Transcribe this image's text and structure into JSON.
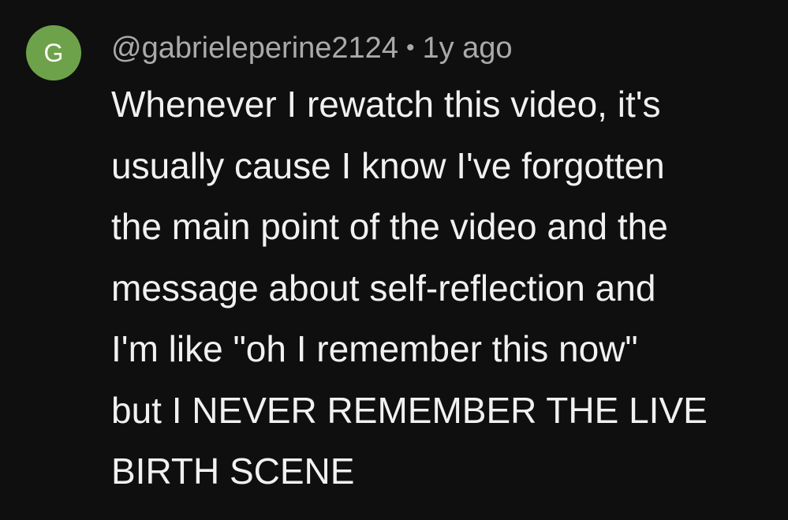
{
  "comment": {
    "avatar_letter": "G",
    "avatar_color": "#6ea24a",
    "author": "@gabrieleperine2124",
    "separator": "•",
    "time": "1y ago",
    "text_lines": [
      "Whenever I rewatch this video, it's",
      "usually cause I know I've forgotten",
      "the main point of the video and the",
      "message about self-reflection and",
      "I'm like \"oh I remember this now\"",
      "but I NEVER REMEMBER THE LIVE",
      "BIRTH SCENE"
    ]
  }
}
